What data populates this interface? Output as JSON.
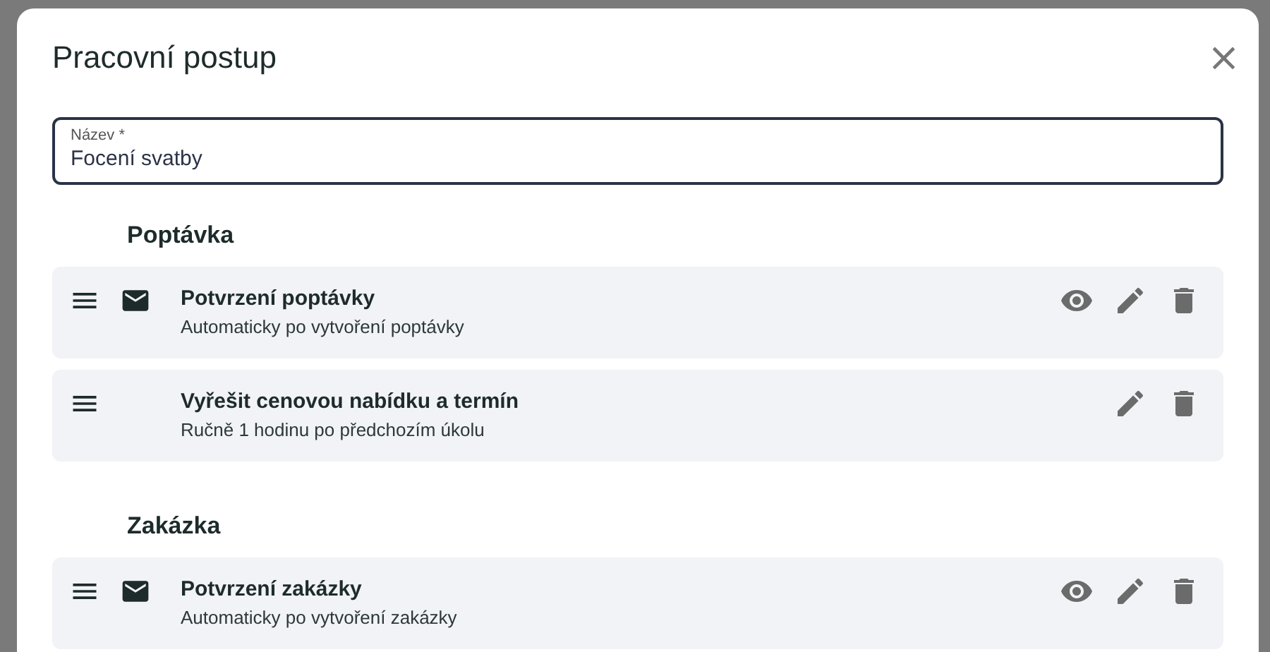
{
  "dialog": {
    "title": "Pracovní postup",
    "close_label": "×"
  },
  "name_field": {
    "label": "Název *",
    "value": "Focení svatby"
  },
  "sections": [
    {
      "title": "Poptávka",
      "tasks": [
        {
          "kind": "email",
          "title": "Potvrzení poptávky",
          "subtitle": "Automaticky po vytvoření poptávky",
          "previewable": true
        },
        {
          "kind": "manual",
          "title": "Vyřešit cenovou nabídku a termín",
          "subtitle": "Ručně 1 hodinu po předchozím úkolu",
          "previewable": false
        }
      ]
    },
    {
      "title": "Zakázka",
      "tasks": [
        {
          "kind": "email",
          "title": "Potvrzení zakázky",
          "subtitle": "Automaticky po vytvoření zakázky",
          "previewable": true
        }
      ]
    }
  ]
}
